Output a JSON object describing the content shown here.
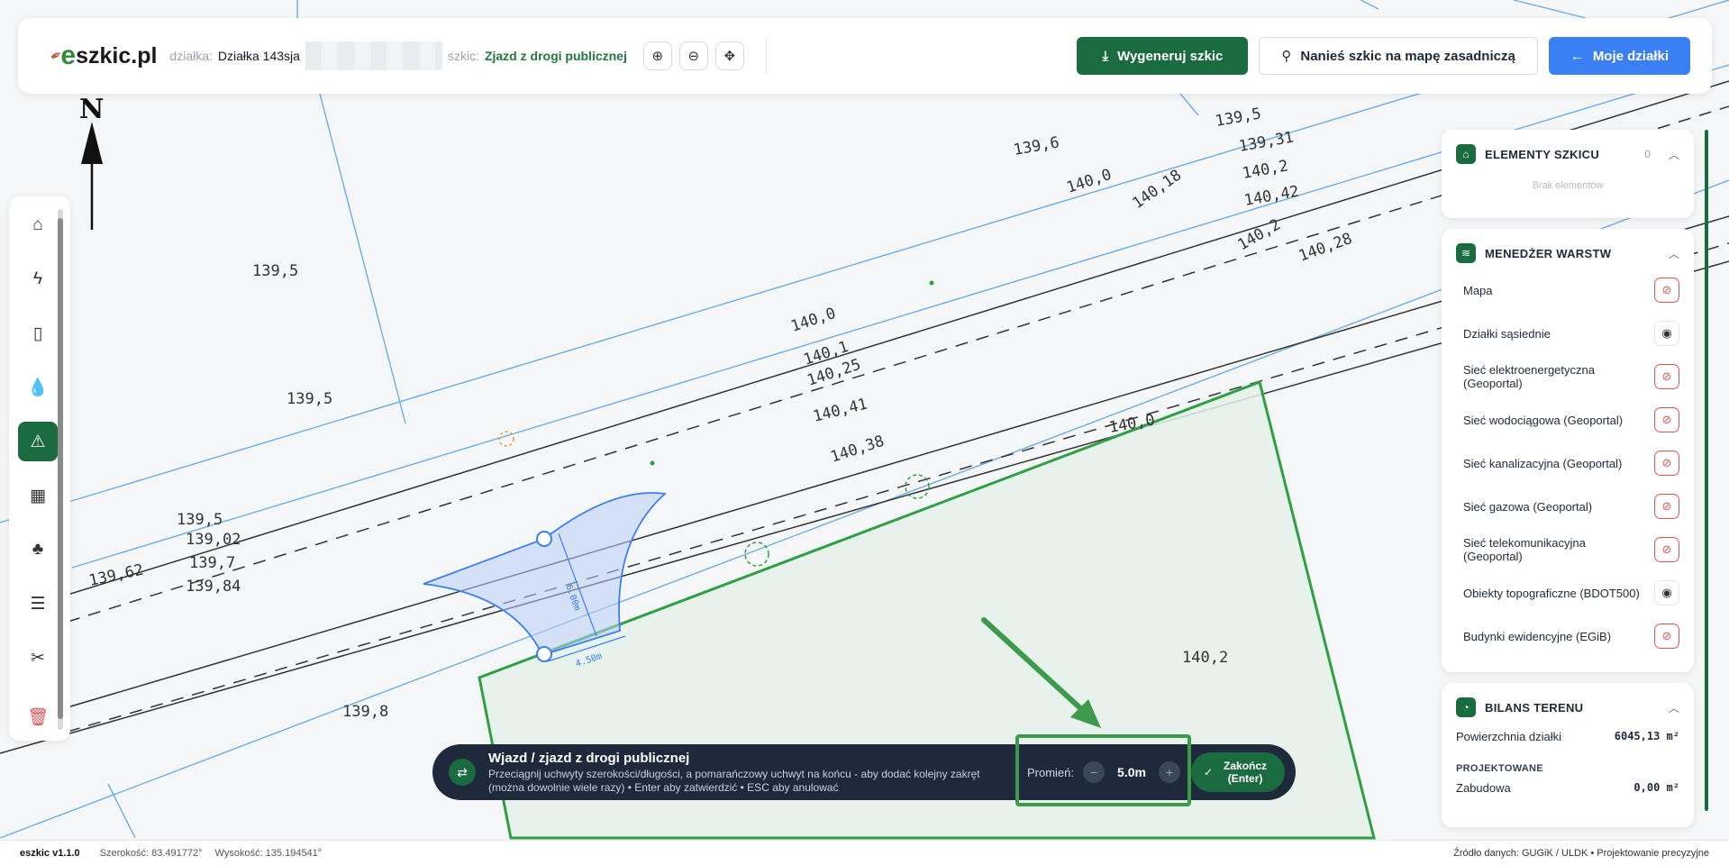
{
  "app": {
    "logo": "eszkic.pl",
    "version": "eszkic v1.1.0"
  },
  "header": {
    "parcel_label": "działka:",
    "parcel_value": "Działka 143sja",
    "sketch_label": "szkic:",
    "sketch_value": "Zjazd z drogi publicznej",
    "generate_button": "Wygeneruj szkic",
    "apply_button": "Nanieś szkic na mapę zasadniczą",
    "my_parcels_button": "Moje działki"
  },
  "map": {
    "north_label": "N",
    "numbers": [
      "139,5",
      "139,5",
      "139,6",
      "140,0",
      "140,1",
      "140,25",
      "140,41",
      "140,38",
      "140,0",
      "140,0",
      "140,2",
      "140,28",
      "140,42",
      "139,31",
      "140,2",
      "140,18",
      "139,5",
      "139,02",
      "139,7",
      "139,84",
      "139,62",
      "139,8",
      "140,2",
      "139,5"
    ],
    "entrance_width_label": "6.00m",
    "entrance_bottom_label": "4.50m"
  },
  "left_toolbar": {
    "items": [
      "home-icon",
      "lightning-icon",
      "toilet-icon",
      "water-drop-icon",
      "road-icon",
      "building-icon",
      "tree-icon",
      "list-icon",
      "tools-icon",
      "trash-icon"
    ],
    "active_index": 4
  },
  "panels": {
    "elements": {
      "title": "ELEMENTY SZKICU",
      "count": "0",
      "empty_text": "Brak elementów"
    },
    "layers": {
      "title": "MENEDŻER WARSTW",
      "items": [
        {
          "name": "Mapa",
          "visible": false
        },
        {
          "name": "Działki sąsiednie",
          "visible": true
        },
        {
          "name": "Sieć elektroenergetyczna (Geoportal)",
          "visible": false
        },
        {
          "name": "Sieć wodociągowa (Geoportal)",
          "visible": false
        },
        {
          "name": "Sieć kanalizacyjna (Geoportal)",
          "visible": false
        },
        {
          "name": "Sieć gazowa (Geoportal)",
          "visible": false
        },
        {
          "name": "Sieć telekomunikacyjna (Geoportal)",
          "visible": false
        },
        {
          "name": "Obiekty topograficzne (BDOT500)",
          "visible": true
        },
        {
          "name": "Budynki ewidencyjne (EGiB)",
          "visible": false
        }
      ]
    },
    "balance": {
      "title": "BILANS TERENU",
      "area_label": "Powierzchnia działki",
      "area_value": "6045,13 m²",
      "projected_title": "PROJEKTOWANE",
      "building_label": "Zabudowa",
      "building_value": "0,00 m²"
    }
  },
  "instruction": {
    "title": "Wjazd / zjazd z drogi publicznej",
    "description": "Przeciągnij uchwyty szerokości/długości, a pomarańczowy uchwyt na końcu - aby dodać kolejny zakręt (można dowolnie wiele razy) • Enter aby zatwierdzić • ESC aby anulować",
    "radius_label": "Promień:",
    "radius_value": "5.0m",
    "finish_label": "Zakończ (Enter)"
  },
  "footer": {
    "latitude": "Szerokość: 83.491772°",
    "longitude": "Wysokość: 135.194541°",
    "source": "Źródło danych: GUGiK / ULDK • Projektowanie precyzyjne"
  },
  "colors": {
    "primary_green": "#1b6b40",
    "accent_blue": "#3b7ff5",
    "parcel_green": "#2ea043",
    "instruction_bg": "#1e2a3b",
    "danger": "#e05454"
  }
}
